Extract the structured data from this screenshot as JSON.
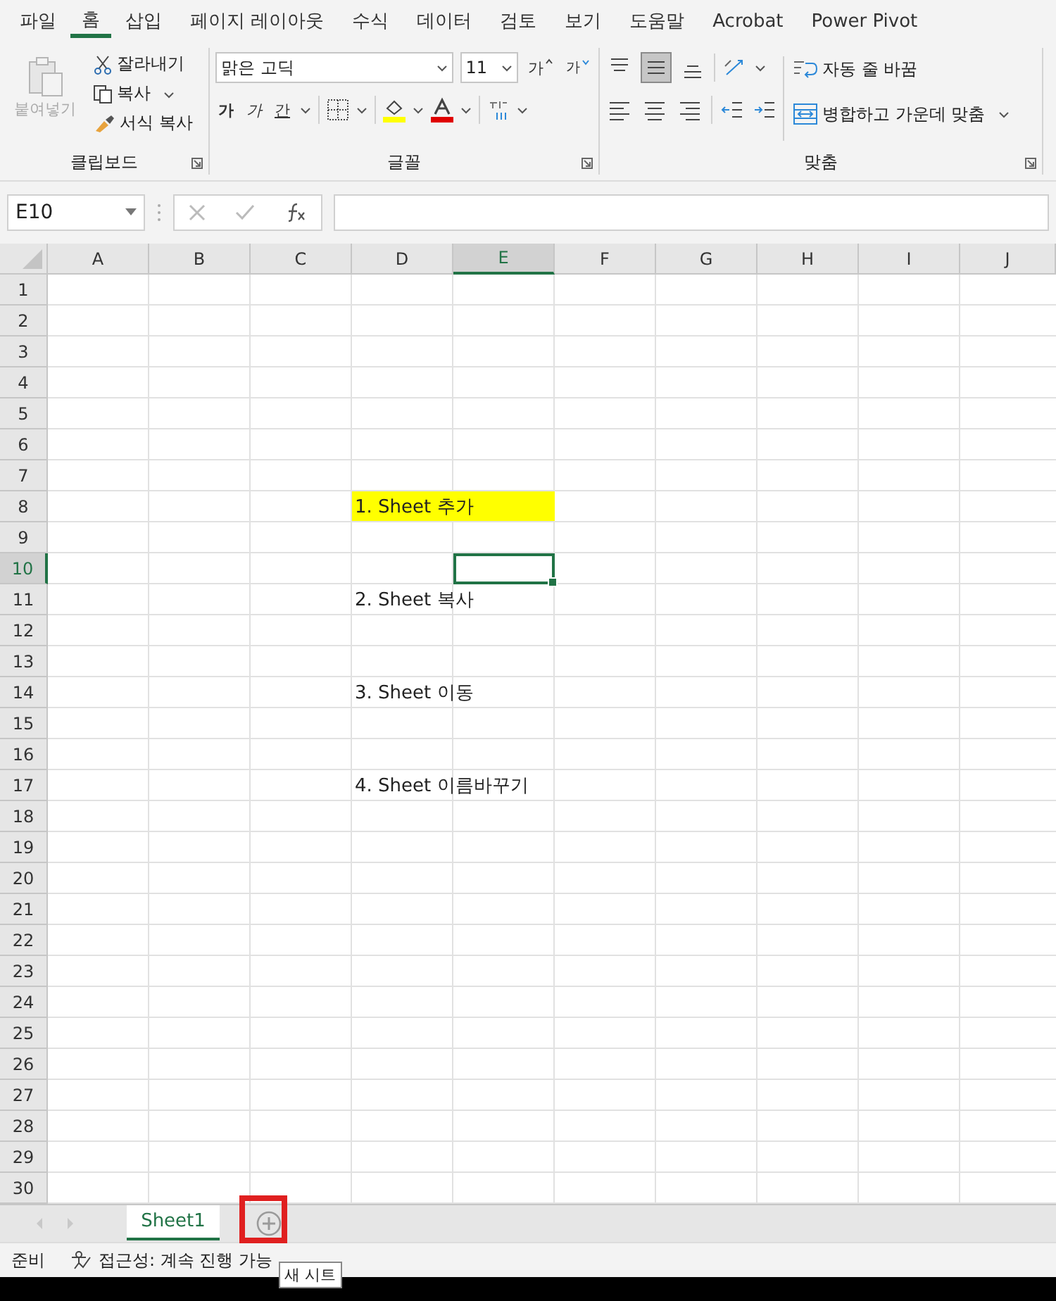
{
  "menu_tabs": [
    {
      "label": "파일",
      "selected": false
    },
    {
      "label": "홈",
      "selected": true
    },
    {
      "label": "삽입",
      "selected": false
    },
    {
      "label": "페이지 레이아웃",
      "selected": false
    },
    {
      "label": "수식",
      "selected": false
    },
    {
      "label": "데이터",
      "selected": false
    },
    {
      "label": "검토",
      "selected": false
    },
    {
      "label": "보기",
      "selected": false
    },
    {
      "label": "도움말",
      "selected": false
    },
    {
      "label": "Acrobat",
      "selected": false
    },
    {
      "label": "Power Pivot",
      "selected": false
    }
  ],
  "clipboard": {
    "paste": "붙여넣기",
    "cut": "잘라내기",
    "copy": "복사",
    "format_painter": "서식 복사",
    "group_label": "클립보드"
  },
  "font": {
    "family": "맑은 고딕",
    "size": "11",
    "bold": "가",
    "italic": "가",
    "underline": "간",
    "grow": "가",
    "shrink": "가",
    "group_label": "글꼴"
  },
  "alignment": {
    "wrap_text": "자동 줄 바꿈",
    "merge_center": "병합하고 가운데 맞춤",
    "group_label": "맞춤"
  },
  "name_box": "E10",
  "columns": [
    {
      "label": "A",
      "selected": false
    },
    {
      "label": "B",
      "selected": false
    },
    {
      "label": "C",
      "selected": false
    },
    {
      "label": "D",
      "selected": false
    },
    {
      "label": "E",
      "selected": true
    },
    {
      "label": "F",
      "selected": false
    },
    {
      "label": "G",
      "selected": false
    },
    {
      "label": "H",
      "selected": false
    },
    {
      "label": "I",
      "selected": false
    },
    {
      "label": "J",
      "selected": false
    }
  ],
  "rows": [
    {
      "label": "1",
      "selected": false
    },
    {
      "label": "2",
      "selected": false
    },
    {
      "label": "3",
      "selected": false
    },
    {
      "label": "4",
      "selected": false
    },
    {
      "label": "5",
      "selected": false
    },
    {
      "label": "6",
      "selected": false
    },
    {
      "label": "7",
      "selected": false
    },
    {
      "label": "8",
      "selected": false,
      "column_d": {
        "text": "1. Sheet 추가",
        "highlight": true
      }
    },
    {
      "label": "9",
      "selected": false
    },
    {
      "label": "10",
      "selected": true
    },
    {
      "label": "11",
      "selected": false,
      "column_d": {
        "text": "2. Sheet 복사",
        "highlight": false
      }
    },
    {
      "label": "12",
      "selected": false
    },
    {
      "label": "13",
      "selected": false
    },
    {
      "label": "14",
      "selected": false,
      "column_d": {
        "text": "3. Sheet 이동",
        "highlight": false
      }
    },
    {
      "label": "15",
      "selected": false
    },
    {
      "label": "16",
      "selected": false
    },
    {
      "label": "17",
      "selected": false,
      "column_d": {
        "text": "4. Sheet 이름바꾸기",
        "highlight": false
      }
    },
    {
      "label": "18",
      "selected": false
    },
    {
      "label": "19",
      "selected": false
    },
    {
      "label": "20",
      "selected": false
    },
    {
      "label": "21",
      "selected": false
    },
    {
      "label": "22",
      "selected": false
    },
    {
      "label": "23",
      "selected": false
    },
    {
      "label": "24",
      "selected": false
    },
    {
      "label": "25",
      "selected": false
    },
    {
      "label": "26",
      "selected": false
    },
    {
      "label": "27",
      "selected": false
    },
    {
      "label": "28",
      "selected": false
    },
    {
      "label": "29",
      "selected": false
    },
    {
      "label": "30",
      "selected": false
    }
  ],
  "sheet_tabs": [
    {
      "label": "Sheet1",
      "selected": true
    }
  ],
  "tooltip": "새 시트",
  "status_bar": {
    "ready": "준비",
    "accessibility": "접근성: 계속 진행 가능"
  }
}
